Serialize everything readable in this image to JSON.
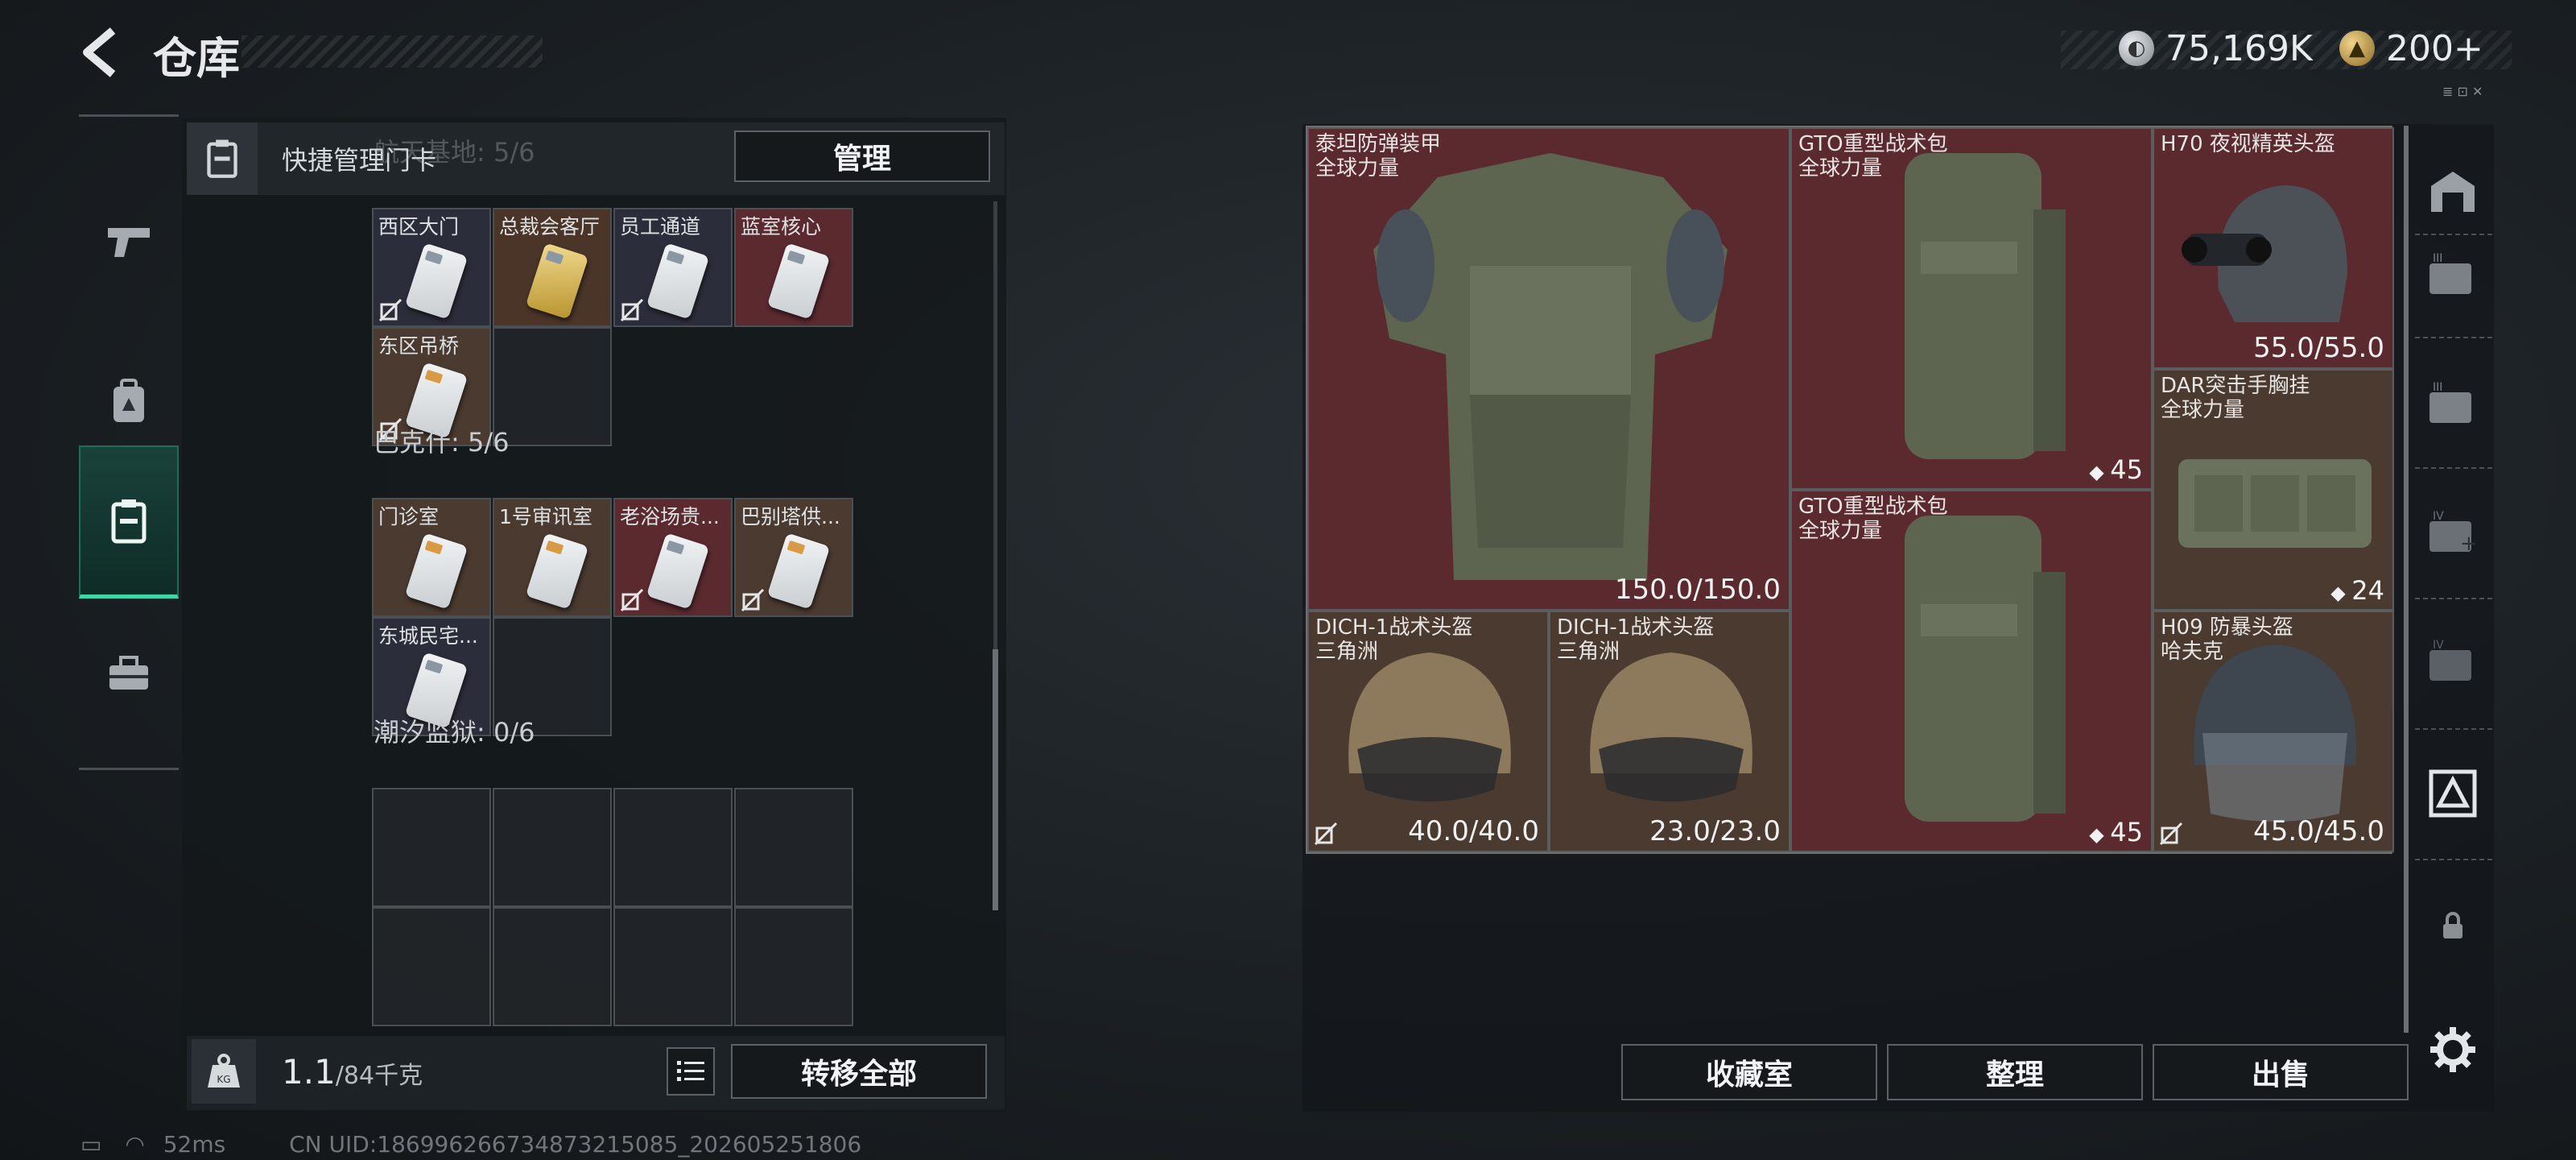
{
  "header": {
    "title": "仓库",
    "currency_a": "75,169K",
    "currency_b": "200+",
    "mini": "≣ ⊡ ✕"
  },
  "left_panel": {
    "quick_manage_label": "快捷管理门卡",
    "manage_button": "管理",
    "sections": [
      {
        "label": "航天基地: 5/6",
        "cards": [
          {
            "name": "西区大门",
            "style": "dark",
            "locked": true
          },
          {
            "name": "总裁会客厅",
            "style": "gold",
            "locked": false
          },
          {
            "name": "员工通道",
            "style": "dark",
            "locked": true
          },
          {
            "name": "蓝室核心",
            "style": "red",
            "locked": false
          },
          {
            "name": "东区吊桥",
            "style": "brown",
            "locked": true
          }
        ]
      },
      {
        "label": "巴克什: 5/6",
        "cards": [
          {
            "name": "门诊室",
            "style": "brown",
            "locked": false
          },
          {
            "name": "1号审讯室",
            "style": "brown",
            "locked": false
          },
          {
            "name": "老浴场贵...",
            "style": "red",
            "locked": true
          },
          {
            "name": "巴别塔供...",
            "style": "brown",
            "locked": true
          },
          {
            "name": "东城民宅...",
            "style": "dark",
            "locked": false
          }
        ]
      },
      {
        "label": "潮汐监狱: 0/6",
        "cards": []
      }
    ],
    "weight_value": "1.1",
    "weight_unit": "/84千克",
    "transfer_all": "转移全部"
  },
  "stash": {
    "items": [
      {
        "name": "泰坦防弹装甲",
        "sub": "全球力量",
        "stat": "150.0/150.0",
        "color": "red"
      },
      {
        "name": "GTO重型战术包",
        "sub": "全球力量",
        "badge": "45",
        "color": "red"
      },
      {
        "name": "H70 夜视精英头盔",
        "sub": "",
        "stat": "55.0/55.0",
        "color": "red"
      },
      {
        "name": "DAR突击手胸挂",
        "sub": "全球力量",
        "badge": "24",
        "color": "brown"
      },
      {
        "name": "GTO重型战术包",
        "sub": "全球力量",
        "badge": "45",
        "color": "red"
      },
      {
        "name": "DICH-1战术头盔",
        "sub": "三角洲",
        "stat": "40.0/40.0",
        "color": "brown"
      },
      {
        "name": "DICH-1战术头盔",
        "sub": "三角洲",
        "stat": "23.0/23.0",
        "color": "brown"
      },
      {
        "name": "H09 防暴头盔",
        "sub": "哈夫克",
        "stat": "45.0/45.0",
        "color": "brown"
      }
    ]
  },
  "bottom_buttons": {
    "collection": "收藏室",
    "organize": "整理",
    "sell": "出售"
  },
  "status": {
    "ping": "52ms",
    "uid": "CN UID:18699626673487321508​5_202605251806"
  }
}
